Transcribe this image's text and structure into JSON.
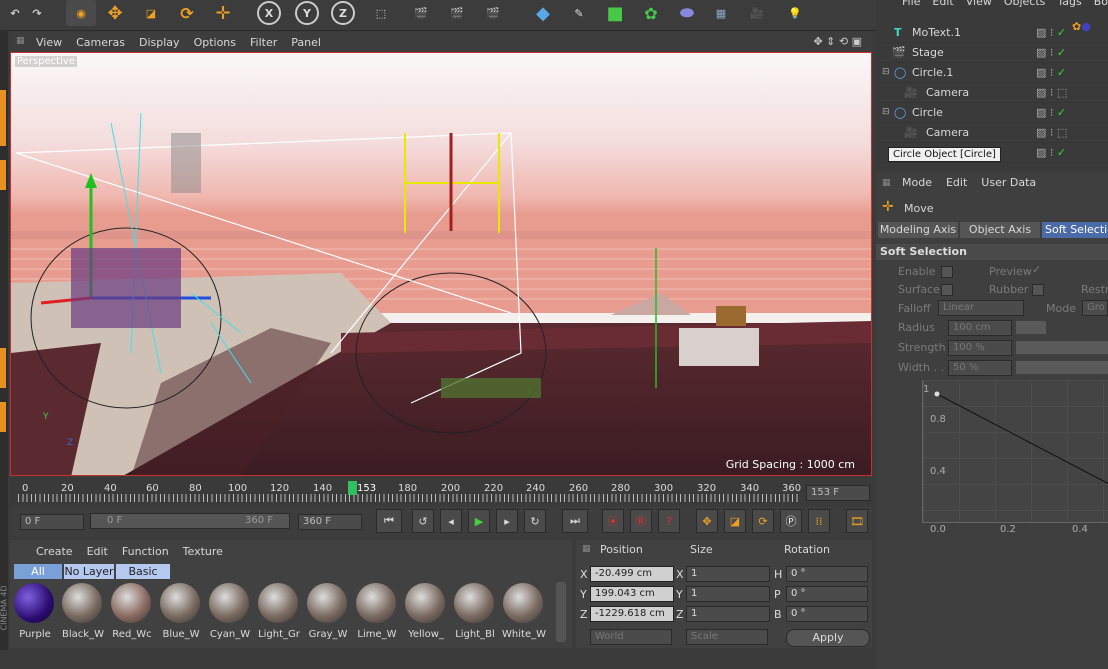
{
  "toolbar": {
    "axis_x": "X",
    "axis_y": "Y",
    "axis_z": "Z"
  },
  "viewport": {
    "menu": [
      "View",
      "Cameras",
      "Display",
      "Options",
      "Filter",
      "Panel"
    ],
    "label": "Perspective",
    "grid_spacing": "Grid Spacing : 1000 cm"
  },
  "timeline": {
    "ticks": [
      "0",
      "20",
      "40",
      "60",
      "80",
      "100",
      "120",
      "140",
      "153",
      "180",
      "200",
      "220",
      "240",
      "260",
      "280",
      "300",
      "320",
      "340",
      "360"
    ],
    "current_frame": "153 F",
    "start": "0 F",
    "range_start": "0 F",
    "range_end": "360 F",
    "end": "360 F"
  },
  "object_manager": {
    "menu": [
      "File",
      "Edit",
      "View",
      "Objects",
      "Tags",
      "Bo"
    ],
    "objects": [
      {
        "name": "MoText.1",
        "icon": "motext-icon"
      },
      {
        "name": "Stage",
        "icon": "stage-icon"
      },
      {
        "name": "Circle.1",
        "icon": "circle-icon"
      },
      {
        "name": "Camera",
        "icon": "camera-icon"
      },
      {
        "name": "Circle",
        "icon": "circle-icon"
      },
      {
        "name": "Camera",
        "icon": "camera-icon"
      }
    ],
    "tooltip": "Circle Object [Circle]"
  },
  "attributes": {
    "menu": [
      "Mode",
      "Edit",
      "User Data"
    ],
    "tool": "Move",
    "tabs": [
      "Modeling Axis",
      "Object Axis",
      "Soft Selection"
    ],
    "section": "Soft Selection",
    "enable": "Enable",
    "preview": "Preview",
    "surface": "Surface",
    "rubber": "Rubber",
    "restrict": "Restr",
    "falloff_label": "Falloff",
    "falloff_value": "Linear",
    "mode_label": "Mode",
    "mode_value": "Gro",
    "radius_label": "Radius",
    "radius_value": "100 cm",
    "strength_label": "Strength",
    "strength_value": "100 %",
    "width_label": "Width . .",
    "width_value": "50 %",
    "graph_y": [
      "1",
      "0.8",
      "0.4",
      "0.0"
    ],
    "graph_x": [
      "0.0",
      "0.2",
      "0.4"
    ]
  },
  "materials": {
    "menu": [
      "Create",
      "Edit",
      "Function",
      "Texture"
    ],
    "filters": [
      "All",
      "No Layer",
      "Basic"
    ],
    "items": [
      {
        "name": "Purple",
        "color": "#3a1a9a"
      },
      {
        "name": "Black_W"
      },
      {
        "name": "Red_Wc"
      },
      {
        "name": "Blue_W"
      },
      {
        "name": "Cyan_W"
      },
      {
        "name": "Light_Gr"
      },
      {
        "name": "Gray_W"
      },
      {
        "name": "Lime_W"
      },
      {
        "name": "Yellow_"
      },
      {
        "name": "Light_Bl"
      },
      {
        "name": "White_W"
      }
    ]
  },
  "coordinates": {
    "headers": [
      "Position",
      "Size",
      "Rotation"
    ],
    "rows": [
      {
        "axis": "X",
        "pos": "-20.499 cm",
        "saxis": "X",
        "size": "1",
        "raxis": "H",
        "rot": "0 °"
      },
      {
        "axis": "Y",
        "pos": "199.043 cm",
        "saxis": "Y",
        "size": "1",
        "raxis": "P",
        "rot": "0 °"
      },
      {
        "axis": "Z",
        "pos": "-1229.618 cm",
        "saxis": "Z",
        "size": "1",
        "raxis": "B",
        "rot": "0 °"
      }
    ],
    "space": "World",
    "mode": "Scale",
    "apply": "Apply"
  },
  "brand": "CINEMA 4D"
}
